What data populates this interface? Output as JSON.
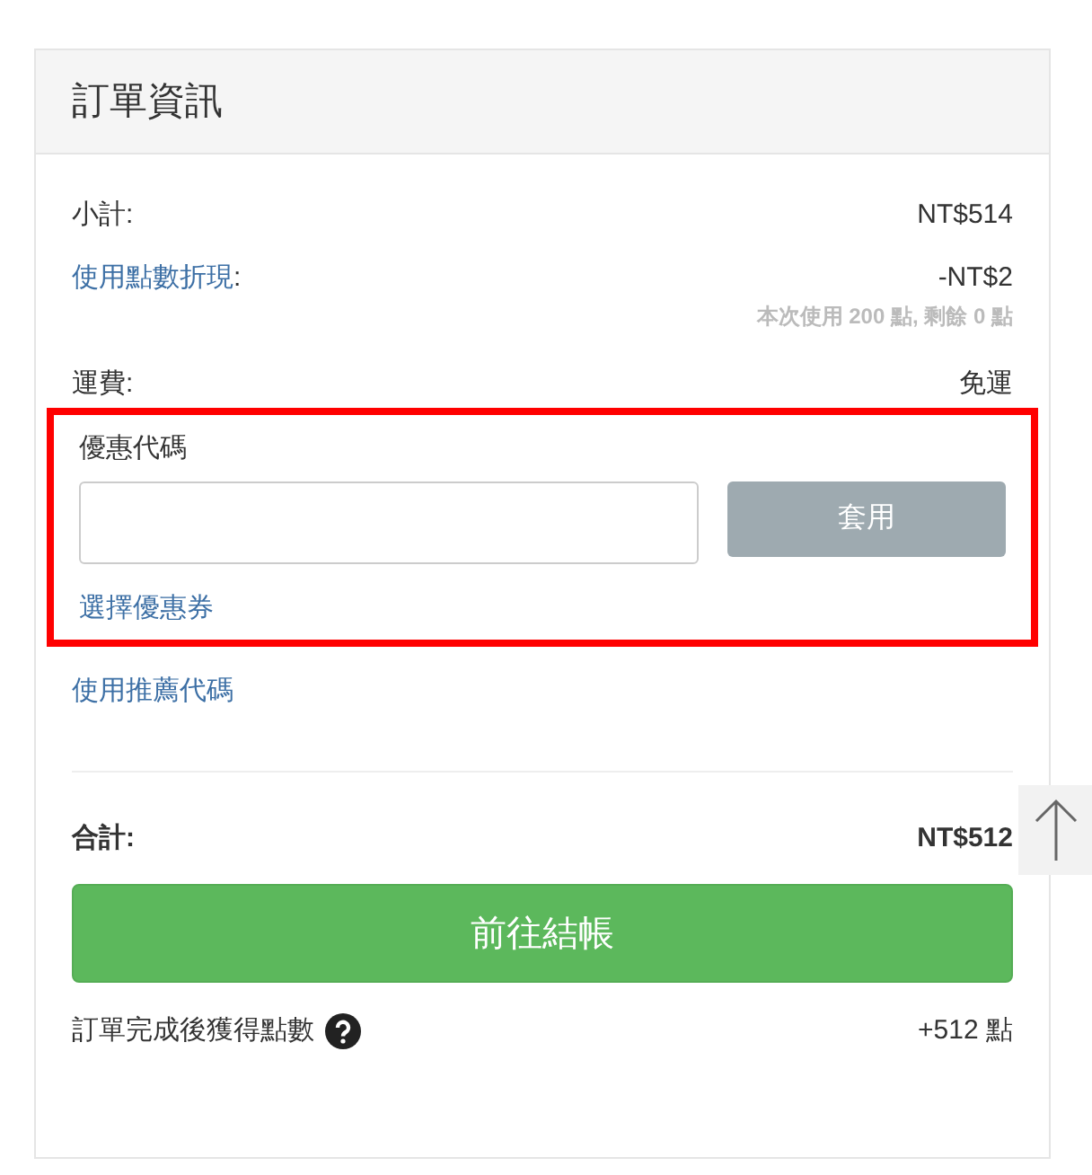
{
  "panel": {
    "title": "訂單資訊"
  },
  "subtotal": {
    "label": "小計:",
    "value": "NT$514"
  },
  "points_discount": {
    "link": "使用點數折現",
    "suffix": ":",
    "value": "-NT$2",
    "note": "本次使用 200 點, 剩餘 0 點"
  },
  "shipping": {
    "label": "運費:",
    "value": "免運"
  },
  "coupon": {
    "label": "優惠代碼",
    "button": "套用",
    "button_disabled": true,
    "link": "選擇優惠券",
    "highlighted": true
  },
  "referral_link": "使用推薦代碼",
  "total": {
    "label": "合計:",
    "value": "NT$512"
  },
  "checkout_button": "前往結帳",
  "reward": {
    "label": "訂單完成後獲得點數",
    "value": "+512 點"
  }
}
